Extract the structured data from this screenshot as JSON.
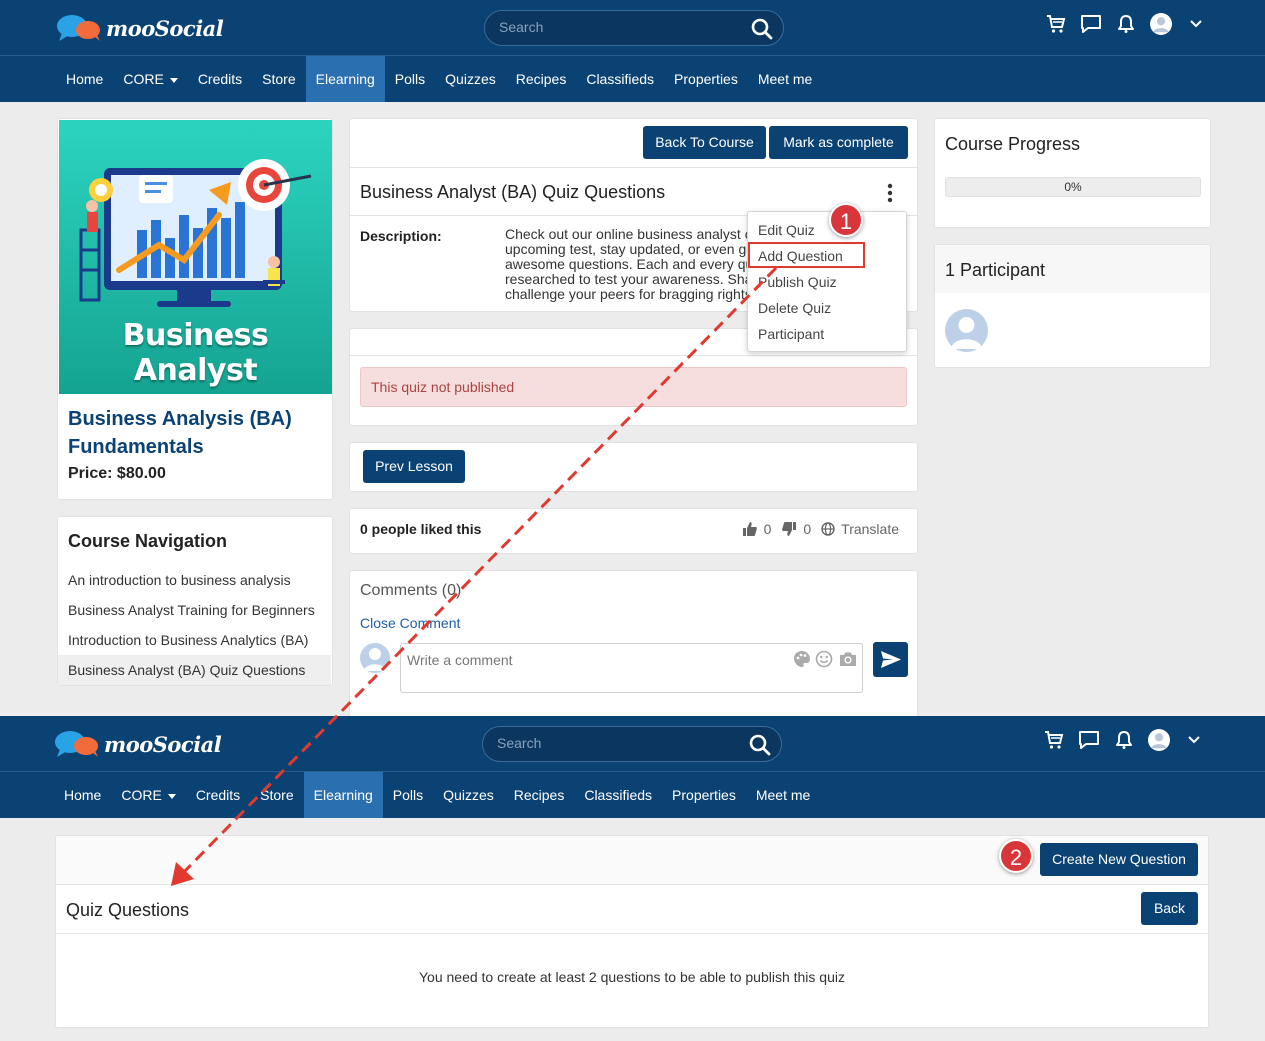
{
  "header": {
    "logo_text": "mooSocial",
    "search_placeholder": "Search"
  },
  "nav": {
    "items": [
      "Home",
      "CORE",
      "Credits",
      "Store",
      "Elearning",
      "Polls",
      "Quizzes",
      "Recipes",
      "Classifieds",
      "Properties",
      "Meet me"
    ],
    "active": "Elearning"
  },
  "course": {
    "image_text": "Business Analyst",
    "title": "Business Analysis (BA) Fundamentals",
    "price": "Price: $80.00"
  },
  "course_navigation": {
    "title": "Course Navigation",
    "items": [
      "An introduction to business analysis",
      "Business Analyst Training for Beginners",
      "Introduction to Business Analytics (BA)",
      "Business Analyst (BA) Quiz Questions"
    ]
  },
  "quiz": {
    "back_to_course": "Back To Course",
    "mark_complete": "Mark as complete",
    "title": "Business Analyst (BA) Quiz Questions",
    "description_label": "Description:",
    "description_lines": [
      "Check out our online business analyst c",
      "upcoming test, stay updated, or even ge",
      "awesome questions. Each and every qu",
      "researched to test your awareness. Sha",
      "challenge your peers for bragging rights"
    ],
    "menu": [
      "Edit Quiz",
      "Add Question",
      "Publish Quiz",
      "Delete Quiz",
      "Participant"
    ],
    "not_published": "This quiz not published",
    "prev_lesson": "Prev Lesson",
    "likes_text": "0 people liked this",
    "like_count": "0",
    "dislike_count": "0",
    "translate": "Translate",
    "comments_title": "Comments (0)",
    "close_comment": "Close Comment",
    "comment_placeholder": "Write a comment"
  },
  "progress": {
    "title": "Course Progress",
    "value": "0%",
    "fraction": 0
  },
  "participants": {
    "title": "1 Participant"
  },
  "quiz_questions_page": {
    "create_button": "Create New Question",
    "title": "Quiz Questions",
    "back_button": "Back",
    "message": "You need to create at least 2 questions to be able to publish this quiz"
  },
  "markers": {
    "step1": "1",
    "step2": "2"
  },
  "colors": {
    "primary": "#0b4274",
    "nav_active": "#2a6fb0",
    "alert_bg": "#f7dede",
    "alert_text": "#a94442",
    "marker": "#d9363b"
  }
}
